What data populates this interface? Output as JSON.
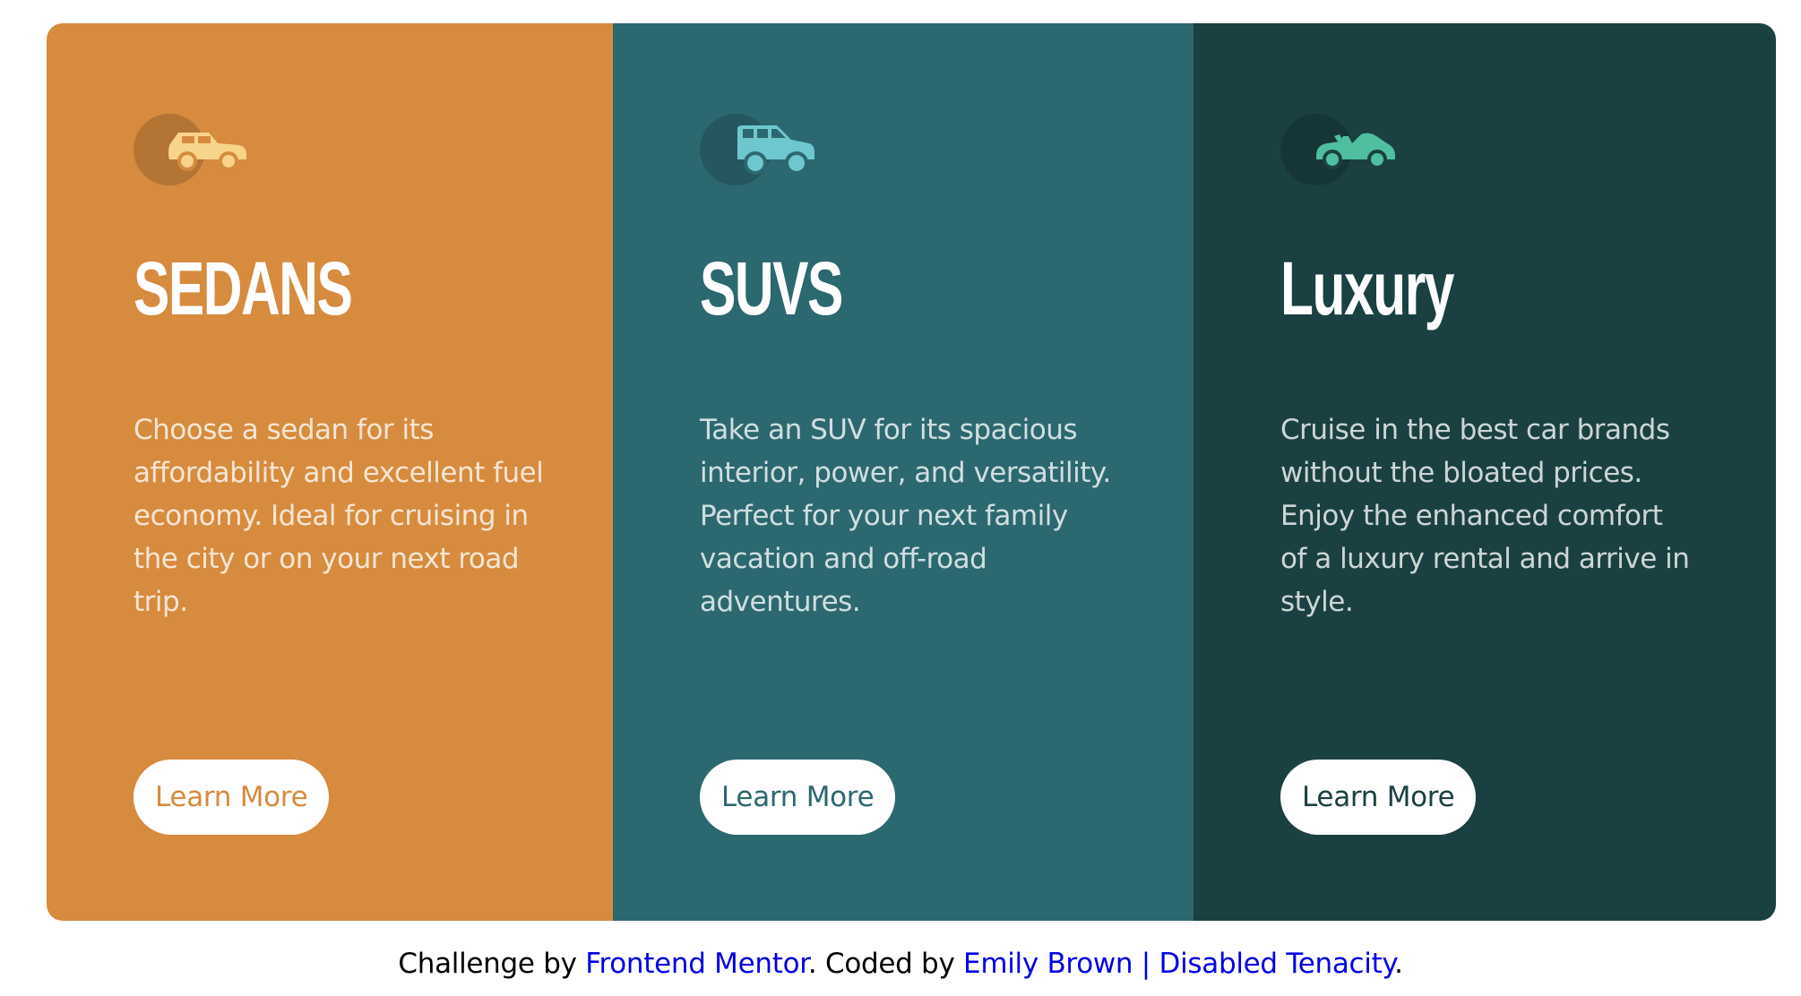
{
  "colors": {
    "sedans": "#d68b3e",
    "suvs": "#2c6870",
    "luxury": "#1b4042",
    "sedans_icon": "#f8d38a",
    "suvs_icon": "#6ec7cf",
    "luxury_icon": "#4fbfa0",
    "link": "#0000e6"
  },
  "cards": [
    {
      "icon": "sedan-icon",
      "title": "SEDANS",
      "text": "Choose a sedan for its affordability and excellent fuel economy. Ideal for cruising in the city or on your next road trip.",
      "button": "Learn More"
    },
    {
      "icon": "suv-icon",
      "title": "SUVS",
      "text": "Take an SUV for its spacious interior, power, and versatility. Perfect for your next family vacation and off-road adventures.",
      "button": "Learn More"
    },
    {
      "icon": "luxury-car-icon",
      "title": "Luxury",
      "text": "Cruise in the best car brands without the bloated prices. Enjoy the enhanced comfort of a luxury rental and arrive in style.",
      "button": "Learn More"
    }
  ],
  "footer": {
    "prefix": "Challenge by ",
    "mentor_link": "Frontend Mentor",
    "middle": ". Coded by ",
    "author_link": "Emily Brown | Disabled Tenacity",
    "suffix": "."
  }
}
